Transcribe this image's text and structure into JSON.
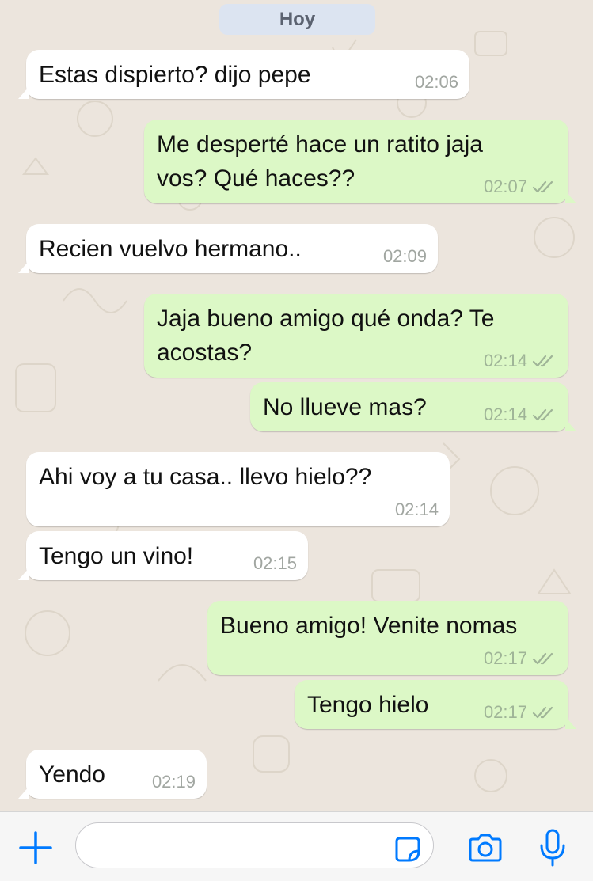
{
  "chat": {
    "date_label": "Hoy",
    "messages": [
      {
        "dir": "in",
        "lines": [
          "Estas dispierto? dijo pepe"
        ],
        "time": "02:06",
        "ticks": false
      },
      {
        "dir": "out",
        "lines": [
          "Me desperté hace un ratito jaja",
          "vos? Qué haces??"
        ],
        "time": "02:07",
        "ticks": true
      },
      {
        "dir": "in",
        "lines": [
          "Recien vuelvo hermano.."
        ],
        "time": "02:09",
        "ticks": false
      },
      {
        "dir": "out",
        "lines": [
          "Jaja bueno amigo qué onda? Te",
          "acostas?"
        ],
        "time": "02:14",
        "ticks": true
      },
      {
        "dir": "out",
        "lines": [
          "No llueve mas?"
        ],
        "time": "02:14",
        "ticks": true
      },
      {
        "dir": "in",
        "lines": [
          "Ahi voy a tu casa.. llevo hielo??"
        ],
        "time": "02:14",
        "ticks": false
      },
      {
        "dir": "in",
        "lines": [
          "Tengo un vino!"
        ],
        "time": "02:15",
        "ticks": false
      },
      {
        "dir": "out",
        "lines": [
          "Bueno amigo! Venite nomas"
        ],
        "time": "02:17",
        "ticks": true
      },
      {
        "dir": "out",
        "lines": [
          "Tengo hielo"
        ],
        "time": "02:17",
        "ticks": true
      },
      {
        "dir": "in",
        "lines": [
          "Yendo"
        ],
        "time": "02:19",
        "ticks": false
      }
    ]
  },
  "input_bar": {
    "message_value": "",
    "icons": [
      "plus-icon",
      "sticker-icon",
      "camera-icon",
      "microphone-icon"
    ],
    "accent_color": "#007aff"
  },
  "colors": {
    "background": "#ece5dd",
    "incoming_bubble": "#ffffff",
    "outgoing_bubble": "#dcf8c6",
    "date_pill": "#dce4f1"
  }
}
